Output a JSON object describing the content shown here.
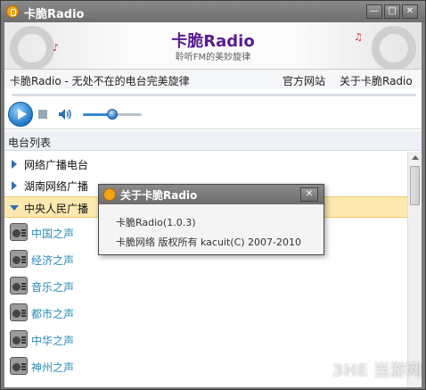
{
  "window": {
    "title": "卡脆Radio"
  },
  "banner": {
    "title": "卡脆Radio",
    "subtitle": "聆听FM的美妙旋律"
  },
  "menu": {
    "slogan": "卡脆Radio - 无处不在的电台完美旋律",
    "links": [
      "官方网站",
      "关于卡脆Radio"
    ]
  },
  "player": {
    "volume_level": 0.5
  },
  "list": {
    "header": "电台列表",
    "groups": [
      "网络广播电台",
      "湖南网络广播",
      "中央人民广播"
    ],
    "stations": [
      "中国之声",
      "经济之声",
      "音乐之声",
      "都市之声",
      "中华之声",
      "神州之声"
    ]
  },
  "dialog": {
    "title": "关于卡脆Radio",
    "line1": "卡脆Radio(1.0.3)",
    "line2": "卡脆网络 版权所有 kacuit(C) 2007-2010"
  },
  "watermark": "3HE 当游网",
  "colors": {
    "accent": "#2c6fb6",
    "station_text": "#2a8bb8",
    "banner_title": "#5a1b8f",
    "selected_row": "#fde8b0"
  }
}
